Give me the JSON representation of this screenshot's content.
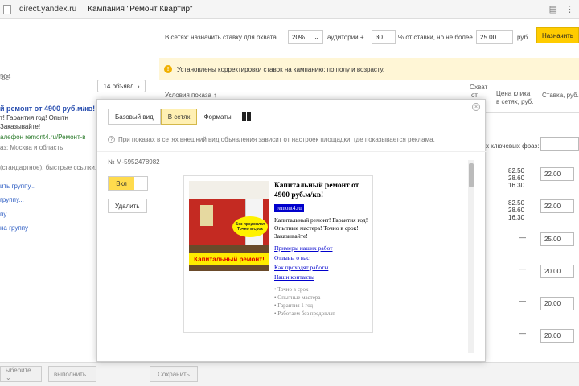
{
  "browser": {
    "url": "direct.yandex.ru",
    "page_title": "Кампания \"Ремонт Квартир\""
  },
  "left_panel": {
    "lines": [
      "82",
      "504",
      "й ремонт от 4900 руб.м/кв!",
      "т! Гарантия год! Опытн",
      "Заказывайте!",
      "алефон  remont4.ru/Ремонт-в",
      "аз: Москва и область",
      "(стандартное), быстрые ссылки,",
      "ить группу...",
      "группу...",
      "пу",
      "на группу"
    ]
  },
  "filter_bar": {
    "label1": "В сетях:  назначить ставку для охвата",
    "coverage": "20%",
    "label2": "аудитории +",
    "audience": "30",
    "label3": "% от ставки, но не более",
    "max_bid": "25.00",
    "currency": "руб.",
    "assign_button": "Назначить"
  },
  "notice": {
    "text": "Установлены корректировки ставок на кампанию: по полу и возрасту."
  },
  "table_head": {
    "conditions": "Условия показа ↑",
    "coverage": "Охват",
    "coverage2": "от",
    "price": "Цена клика",
    "price2": "в сетях, руб.",
    "bid": "Ставка, руб."
  },
  "keywords_label": "х ключевых фраз:",
  "rows": [
    {
      "prices": [
        "82.50",
        "28.60",
        "16.30"
      ],
      "bid": "22.00"
    },
    {
      "prices": [
        "82.50",
        "28.60",
        "16.30"
      ],
      "bid": "22.00"
    },
    {
      "prices": [
        "—"
      ],
      "bid": "25.00"
    },
    {
      "prices": [
        "—"
      ],
      "bid": "20.00"
    },
    {
      "prices": [
        "—"
      ],
      "bid": "20.00"
    },
    {
      "prices": [
        "—"
      ],
      "bid": "20.00"
    }
  ],
  "modal": {
    "tab_label": "14 объявл. ›",
    "tabs": {
      "basic": "Базовый вид",
      "networks": "В сетях",
      "formats": "Форматы"
    },
    "hint": "При показах в сетях внешний вид объявления зависит от настроек площадки, где показывается реклама.",
    "ad_id": "№ M-5952478982",
    "toggle_label": "Вкл",
    "delete_label": "Удалить"
  },
  "ad": {
    "title": "Капитальный ремонт от 4900 руб.м/кв!",
    "domain": "remont4.ru",
    "text": "Капитальный ремонт! Гарантия год! Опытные мастера! Точно в срок! Заказывайте!",
    "image_banner": "Капитальный ремонт!",
    "image_burst": "Без предоплат Точно в срок",
    "sitelinks": [
      "Примеры наших работ",
      "Отзывы о нас",
      "Как проходят работы",
      "Наши контакты"
    ],
    "callouts": [
      "• Точно в срок",
      "• Опытные мастера",
      "• Гарантия 1 год",
      "• Работаем без предоплат"
    ]
  },
  "bottom_bar": {
    "select": "ыберите ⌄",
    "run": "выполнить",
    "save": "Сохранить"
  }
}
